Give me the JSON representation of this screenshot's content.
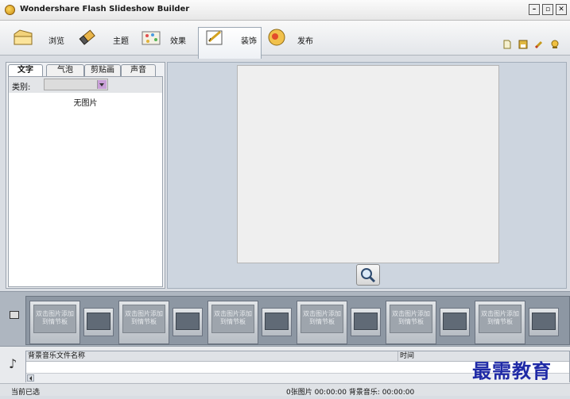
{
  "window": {
    "title": "Wondershare Flash Slideshow Builder"
  },
  "toolbar": {
    "items": [
      {
        "label": "浏览",
        "icon": "folder-icon"
      },
      {
        "label": "主题",
        "icon": "eraser-icon"
      },
      {
        "label": "效果",
        "icon": "effects-icon"
      },
      {
        "label": "装饰",
        "icon": "decorate-icon"
      },
      {
        "label": "发布",
        "icon": "publish-icon"
      }
    ],
    "right_icons": [
      "new-file-icon",
      "save-icon",
      "edit-icon",
      "help-icon"
    ]
  },
  "left_panel": {
    "tabs": [
      {
        "label": "文字"
      },
      {
        "label": "气泡"
      },
      {
        "label": "剪贴画"
      },
      {
        "label": "声音"
      }
    ],
    "category_label": "类别:",
    "category_value": "",
    "empty_text": "无图片"
  },
  "storyboard": {
    "slot_text": "双击图片添加到情节板",
    "slot_count": 6
  },
  "music": {
    "col_name": "背景音乐文件名称",
    "col_time": "时间"
  },
  "status": {
    "left": "当前已选",
    "right": "0张图片  00:00:00  背景音乐: 00:00:00"
  },
  "watermark": {
    "text": "最需教育"
  },
  "colors": {
    "watermark": "#1f2aa6",
    "accent": "#9aa6b3"
  }
}
